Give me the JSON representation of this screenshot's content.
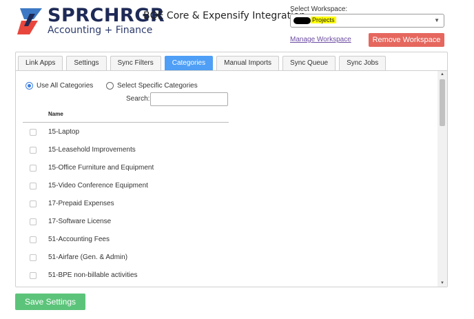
{
  "brand": {
    "name": "SPRCHRGR",
    "subtitle": "Accounting + Finance",
    "app_title": "BQE Core & Expensify Integration",
    "logo_icon": "lightning-logo-icon",
    "colors": {
      "navy": "#1e2a56",
      "red": "#e8463c",
      "blue": "#3d78c4"
    }
  },
  "workspace": {
    "label": "Select Workspace:",
    "selected_value": "Projects",
    "manage_link": "Manage Workspace",
    "remove_label": "Remove Workspace"
  },
  "tabs": [
    {
      "label": "Link Apps",
      "active": false
    },
    {
      "label": "Settings",
      "active": false
    },
    {
      "label": "Sync Filters",
      "active": false
    },
    {
      "label": "Categories",
      "active": true
    },
    {
      "label": "Manual Imports",
      "active": false
    },
    {
      "label": "Sync Queue",
      "active": false
    },
    {
      "label": "Sync Jobs",
      "active": false
    }
  ],
  "categories": {
    "option_all": "Use All Categories",
    "option_specific": "Select Specific Categories",
    "selected_option": "all",
    "search_label": "Search:",
    "search_value": "",
    "column_header": "Name",
    "items": [
      {
        "label": "15-Laptop",
        "checked": false
      },
      {
        "label": "15-Leasehold Improvements",
        "checked": false
      },
      {
        "label": "15-Office Furniture and Equipment",
        "checked": false
      },
      {
        "label": "15-Video Conference Equipment",
        "checked": false
      },
      {
        "label": "17-Prepaid Expenses",
        "checked": false
      },
      {
        "label": "17-Software License",
        "checked": false
      },
      {
        "label": "51-Accounting Fees",
        "checked": false
      },
      {
        "label": "51-Airfare (Gen. & Admin)",
        "checked": false
      },
      {
        "label": "51-BPE non-billable activities",
        "checked": false
      }
    ]
  },
  "footer": {
    "save_label": "Save Settings"
  },
  "theme": {
    "active_tab": "#4e9ff5",
    "remove_button": "#e5675e",
    "save_button": "#5cc47a"
  }
}
